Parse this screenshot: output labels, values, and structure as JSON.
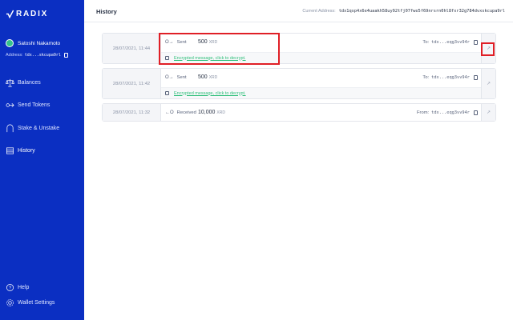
{
  "app": {
    "logo_text": "RADIX"
  },
  "profile": {
    "name": "Satoshi Nakamoto",
    "address_label": "Address:",
    "address": "tdx...skcupa9rl"
  },
  "nav": [
    {
      "label": "Balances",
      "icon": "scale-icon"
    },
    {
      "label": "Send Tokens",
      "icon": "send-icon"
    },
    {
      "label": "Stake & Unstake",
      "icon": "stake-icon"
    },
    {
      "label": "History",
      "icon": "history-icon",
      "active": true
    }
  ],
  "bottom_nav": [
    {
      "label": "Help",
      "icon": "help-icon"
    },
    {
      "label": "Wallet Settings",
      "icon": "gear-icon"
    }
  ],
  "header": {
    "title": "History",
    "current_address_label": "Current Address:",
    "current_address": "tdx1qsp4x6e4uaakh58uy92tfj07fwe5f69nrsrn0hl8fxr32g784dvxskcupa9rl"
  },
  "transactions": [
    {
      "date": "28/07/2021, 11:44",
      "type": "Sent",
      "amount": "500",
      "unit": "XRD",
      "party_label": "To:",
      "party": "tdx...eqg3vv94r",
      "message": "Encrypted message, click to decrypt."
    },
    {
      "date": "28/07/2021, 11:42",
      "type": "Sent",
      "amount": "500",
      "unit": "XRD",
      "party_label": "To:",
      "party": "tdx...eqg3vv94r",
      "message": "Encrypted message, click to decrypt."
    },
    {
      "date": "28/07/2021, 11:32",
      "type": "Received",
      "amount": "10,000",
      "unit": "XRD",
      "party_label": "From:",
      "party": "tdx...eqg3vv94r",
      "message": ""
    }
  ],
  "colors": {
    "sidebar": "#0b2fc2",
    "accent_green": "#2fbf7a",
    "highlight": "#e01f26"
  }
}
